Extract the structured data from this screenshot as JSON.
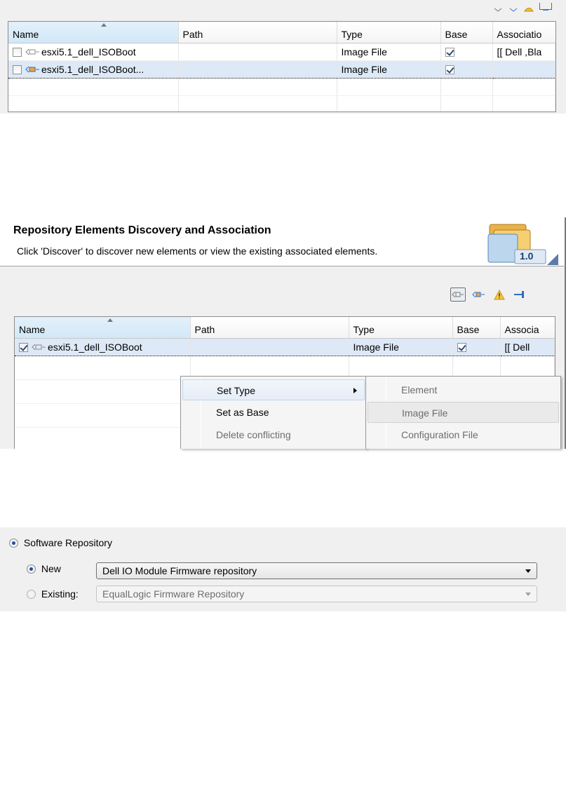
{
  "panel1": {
    "columns": [
      "Name",
      "Path",
      "Type",
      "Base",
      "Associatio"
    ],
    "rows": [
      {
        "name": "esxi5.1_dell_ISOBoot",
        "path": "",
        "type": "Image File",
        "base": true,
        "association": "[[ Dell ,Bla"
      },
      {
        "name": "esxi5.1_dell_ISOBoot...",
        "path": "",
        "type": "Image File",
        "base": true,
        "association": ""
      }
    ]
  },
  "panel2": {
    "title": "Repository Elements Discovery and Association",
    "description": "Click 'Discover' to discover new elements or view the existing associated  elements.",
    "version_badge": "1.0",
    "toolbar_icons": [
      "element-icon",
      "image-file-icon",
      "warning-icon",
      "config-file-icon"
    ],
    "columns": [
      "Name",
      "Path",
      "Type",
      "Base",
      "Associa"
    ],
    "rows": [
      {
        "name": "esxi5.1_dell_ISOBoot",
        "type": "Image File",
        "base": true,
        "association": "[[ Dell"
      }
    ],
    "context_menu": [
      "Set Type",
      "Set as Base",
      "Delete conflicting"
    ],
    "submenu": [
      "Element",
      "Image File",
      "Configuration File"
    ]
  },
  "panel3": {
    "software_repository_label": "Software Repository",
    "new_label": "New",
    "new_value": "Dell IO Module Firmware repository",
    "existing_label": "Existing:",
    "existing_value": "EqualLogic Firmware Repository"
  }
}
